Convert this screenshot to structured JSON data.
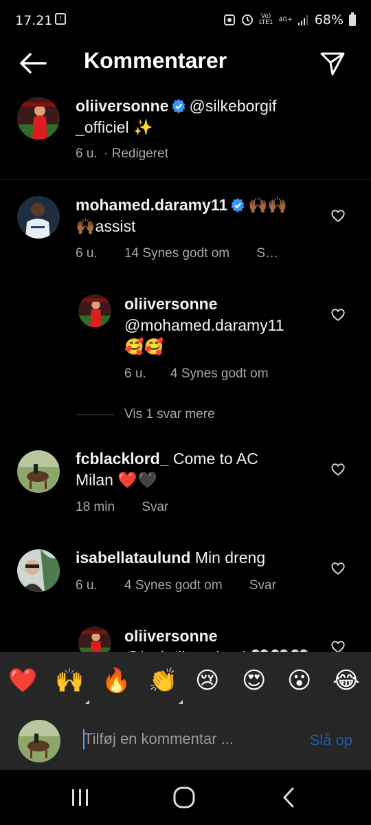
{
  "status_bar": {
    "time": "17.21",
    "network_label_top": "Vo)",
    "network_label_bottom": "LTE1",
    "signal_label": "4G+",
    "battery": "68%"
  },
  "header": {
    "title": "Kommentarer",
    "back_icon": "arrow-left-icon",
    "send_icon": "paper-plane-icon"
  },
  "caption": {
    "username": "oliiversonne",
    "text_line1": "@silkeborgif",
    "text_line2": "_officiel ✨",
    "time": "6 u.",
    "edited": "· Redigeret"
  },
  "comments": [
    {
      "username": "mohamed.daramy11",
      "text_line1": "🙌🏾🙌🏾",
      "text_line2": "🙌🏾assist",
      "time": "6 u.",
      "likes": "14 Synes godt om",
      "reply": "S…"
    },
    {
      "username": "oliiversonne",
      "text_line1": "@mohamed.daramy11",
      "text_line2": "🥰🥰",
      "time": "6 u.",
      "likes": "4 Synes godt om"
    },
    {
      "username": "fcblacklord_",
      "text_line1": "Come to AC",
      "text_line2": "Milan ❤️🖤",
      "time": "18 min",
      "reply": "Svar"
    },
    {
      "username": "isabellataulund",
      "text_line1": "Min dreng",
      "time": "6 u.",
      "likes": "4 Synes godt om",
      "reply": "Svar"
    },
    {
      "username": "oliiversonne",
      "text_line1": "@isabellataulund 🤍🤍🤍"
    }
  ],
  "view_more_replies": "Vis 1 svar mere",
  "emoji_reactions": [
    "❤️",
    "🙌",
    "🔥",
    "👏",
    "😢",
    "😍",
    "😮",
    "😂"
  ],
  "input": {
    "placeholder": "Tilføj en kommentar ...",
    "post_label": "Slå op"
  },
  "nav": {
    "recent_icon": "recent-apps-icon",
    "home_icon": "home-icon",
    "back_icon": "back-icon"
  },
  "colors": {
    "background": "#000000",
    "secondary_text": "#a8a8a8",
    "verified_blue": "#3897f0",
    "bar_background": "#262626",
    "post_button": "#1d5ea5"
  }
}
